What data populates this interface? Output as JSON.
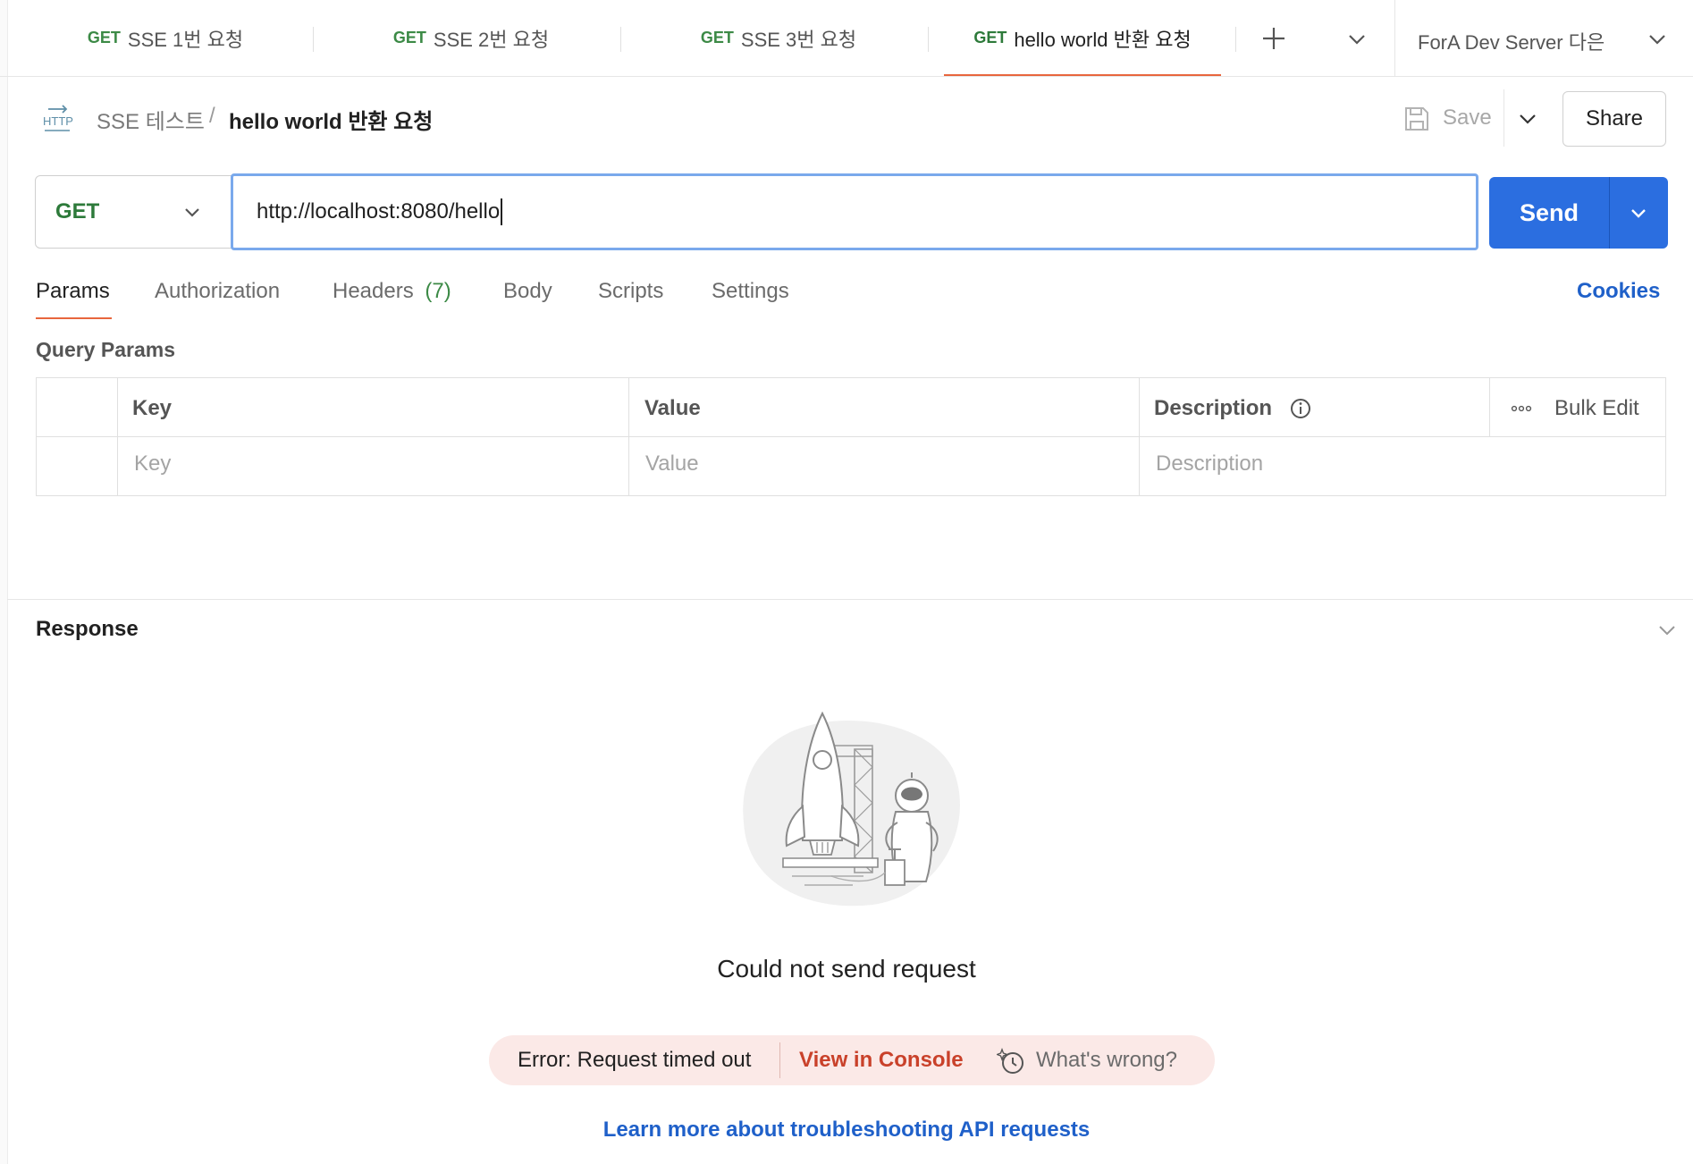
{
  "tabs": [
    {
      "method": "GET",
      "label": "SSE 1번 요청"
    },
    {
      "method": "GET",
      "label": "SSE 2번 요청"
    },
    {
      "method": "GET",
      "label": "SSE 3번 요청"
    },
    {
      "method": "GET",
      "label": "hello world 반환 요청",
      "active": true
    }
  ],
  "environment": {
    "label": "ForA Dev Server 다은"
  },
  "breadcrumb": {
    "collection": "SSE 테스트",
    "separator": "/",
    "request": "hello world 반환 요청"
  },
  "toolbar": {
    "save_label": "Save",
    "share_label": "Share"
  },
  "request": {
    "method": "GET",
    "url": "http://localhost:8080/hello",
    "send_label": "Send"
  },
  "request_tabs": {
    "params": "Params",
    "authorization": "Authorization",
    "headers": "Headers",
    "headers_count": "(7)",
    "body": "Body",
    "scripts": "Scripts",
    "settings": "Settings",
    "cookies": "Cookies"
  },
  "query_params": {
    "title": "Query Params",
    "columns": {
      "key": "Key",
      "value": "Value",
      "description": "Description"
    },
    "bulk_edit": "Bulk Edit",
    "placeholders": {
      "key": "Key",
      "value": "Value",
      "description": "Description"
    }
  },
  "response": {
    "title": "Response",
    "message": "Could not send request",
    "error_text": "Error: Request timed out",
    "view_console": "View in Console",
    "whats_wrong": "What's wrong?",
    "learn_more": "Learn more about troubleshooting API requests"
  },
  "colors": {
    "accent": "#e8663d",
    "send": "#2b6ee0",
    "get": "#2d7a3a",
    "link": "#1f60c9",
    "error_bg": "#fbe9e7"
  }
}
